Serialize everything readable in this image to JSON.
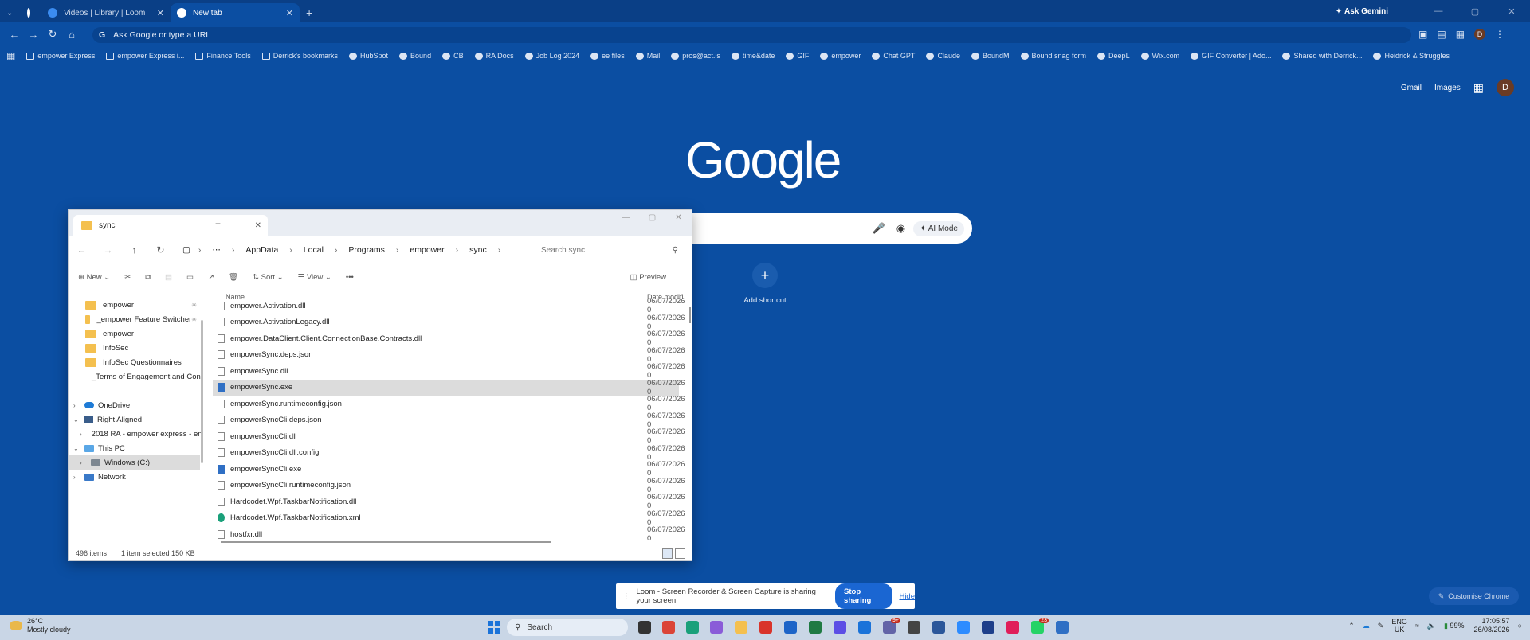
{
  "browser": {
    "tabs": [
      {
        "label": "Videos | Library | Loom",
        "color": "#3b8cf0"
      },
      {
        "label": "New tab",
        "color": "#ffffff"
      }
    ],
    "ask_gemini": "Ask Gemini",
    "omnibox_placeholder": "Ask Google or type a URL",
    "bookmarks": [
      {
        "label": "empower Express",
        "icon": "folder"
      },
      {
        "label": "empower Express i...",
        "icon": "folder"
      },
      {
        "label": "Finance Tools",
        "icon": "folder"
      },
      {
        "label": "Derrick's bookmarks",
        "icon": "folder"
      },
      {
        "label": "HubSpot",
        "icon": "hubspot"
      },
      {
        "label": "Bound",
        "icon": "bound"
      },
      {
        "label": "CB",
        "icon": "cb"
      },
      {
        "label": "RA Docs",
        "icon": "drive"
      },
      {
        "label": "Job Log 2024",
        "icon": "drive"
      },
      {
        "label": "ee files",
        "icon": "drive"
      },
      {
        "label": "Mail",
        "icon": "mail"
      },
      {
        "label": "pros@act.is",
        "icon": "mail"
      },
      {
        "label": "time&date",
        "icon": "clock"
      },
      {
        "label": "GIF",
        "icon": "youtube"
      },
      {
        "label": "empower",
        "icon": "empower"
      },
      {
        "label": "Chat GPT",
        "icon": "chatgpt"
      },
      {
        "label": "Claude",
        "icon": "claude"
      },
      {
        "label": "BoundM",
        "icon": "slack"
      },
      {
        "label": "Bound snag form",
        "icon": "bound"
      },
      {
        "label": "DeepL",
        "icon": "deepl"
      },
      {
        "label": "Wix.com",
        "icon": "wix"
      },
      {
        "label": "GIF Converter | Ado...",
        "icon": "adobe"
      },
      {
        "label": "Shared with Derrick...",
        "icon": "onedrive"
      },
      {
        "label": "Heidrick & Struggles",
        "icon": "globe"
      }
    ]
  },
  "ntp": {
    "gmail": "Gmail",
    "images": "Images",
    "avatar_letter": "D",
    "logo": "Google",
    "ai_mode": "AI Mode",
    "add_shortcut": "Add shortcut",
    "customise": "Customise Chrome"
  },
  "explorer": {
    "tab_title": "sync",
    "breadcrumb": [
      "AppData",
      "Local",
      "Programs",
      "empower",
      "sync"
    ],
    "search_placeholder": "Search sync",
    "cmd": {
      "new": "New",
      "sort": "Sort",
      "view": "View",
      "more": "•••",
      "preview": "Preview"
    },
    "sidebar": [
      {
        "label": "empower",
        "type": "folder",
        "pinned": true
      },
      {
        "label": "_empower Feature Switcher",
        "type": "folder",
        "pinned": true
      },
      {
        "label": "empower",
        "type": "folder",
        "pinned": false
      },
      {
        "label": "InfoSec",
        "type": "folder",
        "pinned": false
      },
      {
        "label": "InfoSec Questionnaires",
        "type": "folder",
        "pinned": false
      },
      {
        "label": "_Terms of Engagement and Cond",
        "type": "folder",
        "pinned": false
      },
      {
        "label": "OneDrive",
        "type": "cloud",
        "chev": ">"
      },
      {
        "label": "Right Aligned",
        "type": "ra",
        "chev": "v"
      },
      {
        "label": "2018 RA - empower express - en",
        "type": "folder",
        "chev": ">"
      },
      {
        "label": "This PC",
        "type": "pc",
        "chev": "v"
      },
      {
        "label": "Windows (C:)",
        "type": "drive",
        "chev": ">",
        "selected": true
      },
      {
        "label": "Network",
        "type": "net",
        "chev": ">"
      }
    ],
    "columns": {
      "name": "Name",
      "date": "Date modifi"
    },
    "files": [
      {
        "name": "empower.Activation.dll",
        "date": "06/07/2026 0",
        "type": "file"
      },
      {
        "name": "empower.ActivationLegacy.dll",
        "date": "06/07/2026 0",
        "type": "file"
      },
      {
        "name": "empower.DataClient.Client.ConnectionBase.Contracts.dll",
        "date": "06/07/2026 0",
        "type": "file"
      },
      {
        "name": "empowerSync.deps.json",
        "date": "06/07/2026 0",
        "type": "file"
      },
      {
        "name": "empowerSync.dll",
        "date": "06/07/2026 0",
        "type": "file"
      },
      {
        "name": "empowerSync.exe",
        "date": "06/07/2026 0",
        "type": "exe",
        "selected": true
      },
      {
        "name": "empowerSync.runtimeconfig.json",
        "date": "06/07/2026 0",
        "type": "file"
      },
      {
        "name": "empowerSyncCli.deps.json",
        "date": "06/07/2026 0",
        "type": "file"
      },
      {
        "name": "empowerSyncCli.dll",
        "date": "06/07/2026 0",
        "type": "file"
      },
      {
        "name": "empowerSyncCli.dll.config",
        "date": "06/07/2026 0",
        "type": "file"
      },
      {
        "name": "empowerSyncCli.exe",
        "date": "06/07/2026 0",
        "type": "exe"
      },
      {
        "name": "empowerSyncCli.runtimeconfig.json",
        "date": "06/07/2026 0",
        "type": "file"
      },
      {
        "name": "Hardcodet.Wpf.TaskbarNotification.dll",
        "date": "06/07/2026 0",
        "type": "file"
      },
      {
        "name": "Hardcodet.Wpf.TaskbarNotification.xml",
        "date": "06/07/2026 0",
        "type": "edge"
      },
      {
        "name": "hostfxr.dll",
        "date": "06/07/2026 0",
        "type": "file"
      }
    ],
    "status": {
      "items": "496 items",
      "selected": "1 item selected  150 KB"
    }
  },
  "share_bar": {
    "text": "Loom - Screen Recorder & Screen Capture is sharing your screen.",
    "stop": "Stop sharing",
    "hide": "Hide"
  },
  "taskbar": {
    "temp": "26°C",
    "weather": "Mostly cloudy",
    "search": "Search",
    "badges": {
      "teams": "9+",
      "whatsapp": "23"
    },
    "lang1": "ENG",
    "lang2": "UK",
    "battery": "99%",
    "time": "17:05:57",
    "date": "26/08/2026"
  }
}
